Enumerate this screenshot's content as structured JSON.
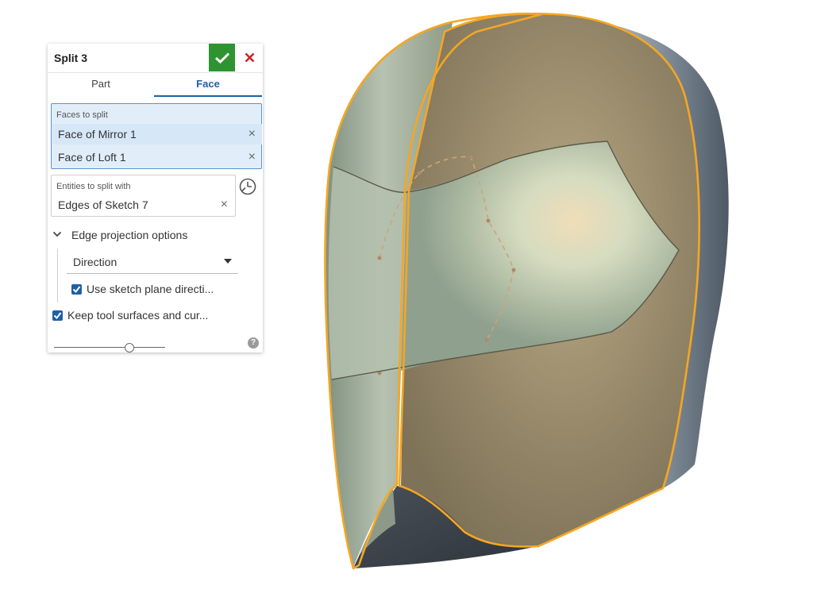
{
  "dialog": {
    "title": "Split 3",
    "ok_icon": "checkmark-icon",
    "cancel_icon": "close-icon",
    "tabs": [
      {
        "label": "Part",
        "active": false
      },
      {
        "label": "Face",
        "active": true
      }
    ],
    "faces_to_split": {
      "label": "Faces to split",
      "items": [
        "Face of Mirror 1",
        "Face of Loft 1"
      ]
    },
    "entities_to_split_with": {
      "label": "Entities to split with",
      "items": [
        "Edges of Sketch 7"
      ],
      "icon": "clock-history-icon"
    },
    "edge_projection": {
      "label": "Edge projection options",
      "expanded": true,
      "direction_label": "Direction",
      "use_sketch_plane_label": "Use sketch plane directi...",
      "use_sketch_plane_checked": true
    },
    "keep_tool_surfaces": {
      "label": "Keep tool surfaces and cur...",
      "checked": true
    },
    "slider_level": 0.68,
    "help_icon": "help-icon"
  },
  "colors": {
    "accent": "#1f5fa8",
    "ok_green": "#2e9431",
    "cancel_red": "#c62828",
    "selection_edge": "#f5a623",
    "face_tan": "#9a8a66",
    "face_sage": "#a8b29a",
    "shadow_grey": "#3f4650"
  }
}
